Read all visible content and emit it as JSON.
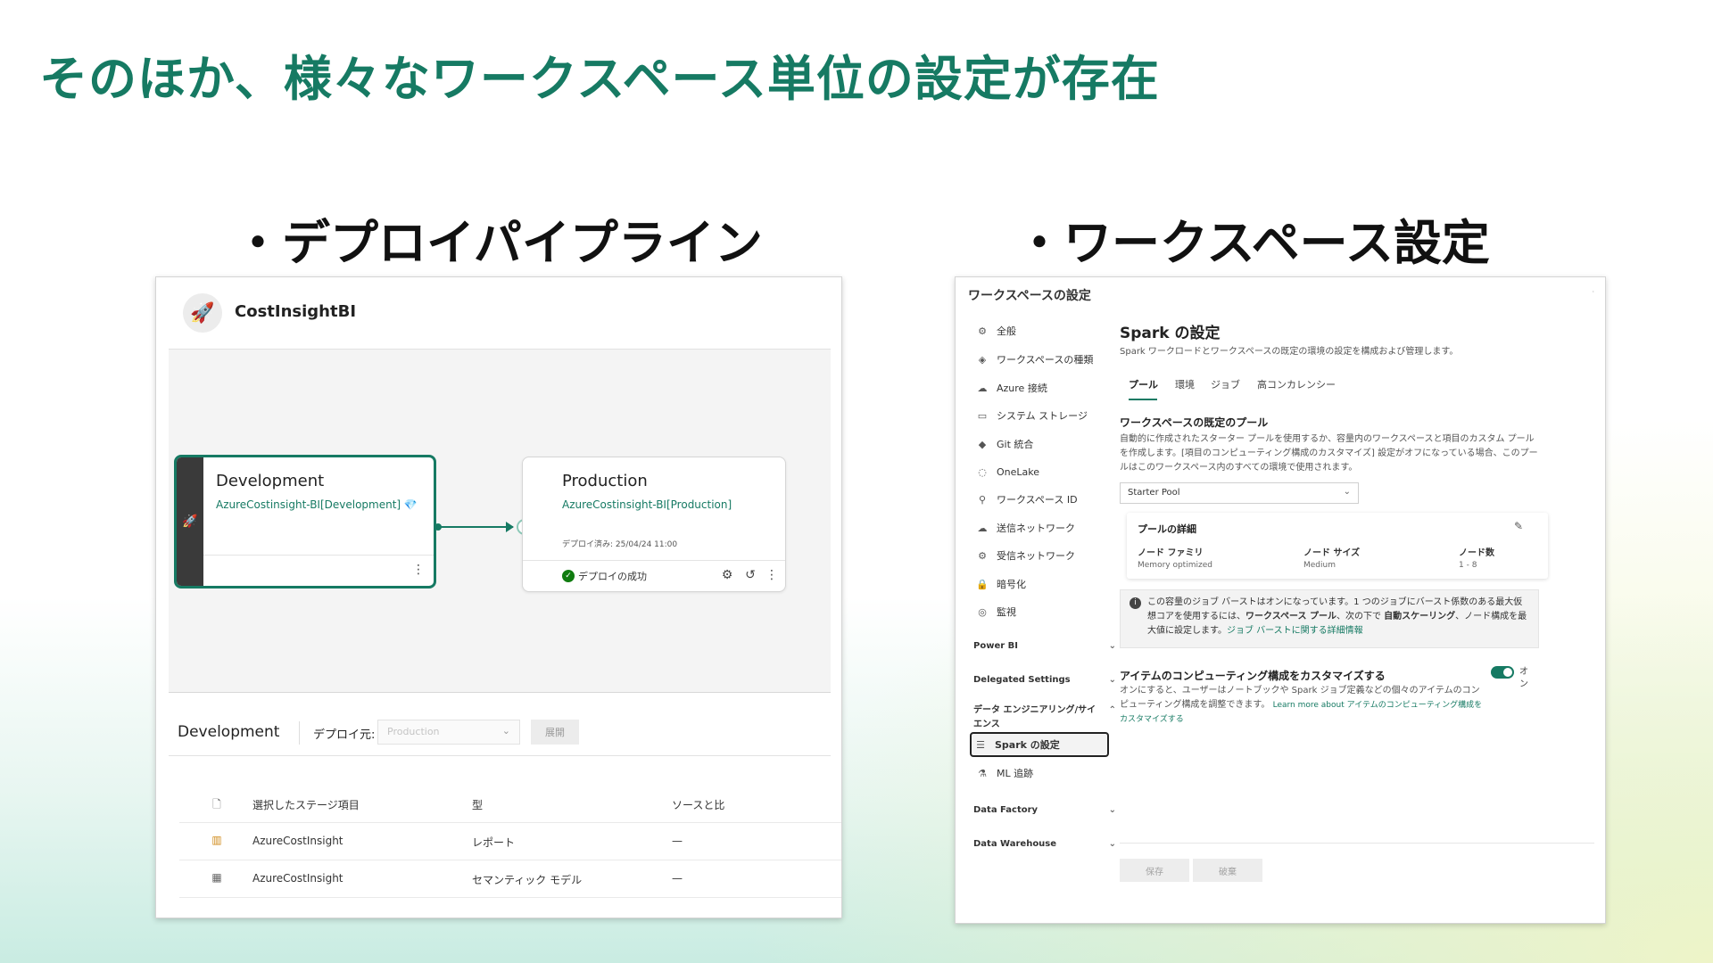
{
  "slide": {
    "title": "そのほか、様々なワークスペース単位の設定が存在",
    "left_heading": "・デプロイパイプライン",
    "right_heading": "・ワークスペース設定",
    "accent": "#167a63"
  },
  "pipeline": {
    "name": "CostInsightBI",
    "logo_icon": "rocket-icon",
    "dev_stage": {
      "title": "Development",
      "workspace": "AzureCostinsight-BI[Development] 💎"
    },
    "prod_stage": {
      "title": "Production",
      "workspace": "AzureCostinsight-BI[Production]",
      "deployed_at": "デプロイ済み: 25/04/24 11:00",
      "status": "デプロイの成功"
    },
    "toolbar": {
      "stage": "Development",
      "deploy_label": "デプロイ元:",
      "deploy_source": "Production",
      "expand_label": "展開"
    },
    "table": {
      "headers": {
        "name": "選択したステージ項目",
        "type": "型",
        "compare": "ソースと比"
      },
      "rows": [
        {
          "icon": "report-icon",
          "name": "AzureCostInsight",
          "type": "レポート",
          "compare": "—"
        },
        {
          "icon": "semantic-model-icon",
          "name": "AzureCostInsight",
          "type": "セマンティック モデル",
          "compare": "—"
        }
      ]
    }
  },
  "workspace": {
    "title": "ワークスペースの設定",
    "nav": {
      "items": [
        {
          "icon": "gear-icon",
          "label": "全般"
        },
        {
          "icon": "diamond-icon",
          "label": "ワークスペースの種類"
        },
        {
          "icon": "cloud-icon",
          "label": "Azure 接続"
        },
        {
          "icon": "storage-icon",
          "label": "システム ストレージ"
        },
        {
          "icon": "git-icon",
          "label": "Git 統合"
        },
        {
          "icon": "onelake-icon",
          "label": "OneLake"
        },
        {
          "icon": "identity-icon",
          "label": "ワークスペース ID"
        },
        {
          "icon": "outbound-network-icon",
          "label": "送信ネットワーク"
        },
        {
          "icon": "inbound-network-icon",
          "label": "受信ネットワーク"
        },
        {
          "icon": "lock-icon",
          "label": "暗号化"
        },
        {
          "icon": "monitor-icon",
          "label": "監視"
        }
      ],
      "groups": {
        "power_bi": "Power BI",
        "delegated": "Delegated Settings",
        "data_eng": "データ エンジニアリング/サイエンス",
        "data_factory": "Data Factory",
        "data_warehouse": "Data Warehouse"
      },
      "sub": {
        "spark": {
          "icon": "sliders-icon",
          "label": "Spark の設定"
        },
        "ml": {
          "icon": "flask-icon",
          "label": "ML 追跡"
        }
      }
    },
    "main": {
      "title": "Spark の設定",
      "description": "Spark ワークロードとワークスペースの既定の環境の設定を構成および管理します。",
      "tabs": [
        "プール",
        "環境",
        "ジョブ",
        "高コンカレンシー"
      ],
      "active_tab": "プール",
      "section_title": "ワークスペースの既定のプール",
      "section_desc": "自動的に作成されたスターター プールを使用するか、容量内のワークスペースと項目のカスタム プールを作成します。[項目のコンピューティング構成のカスタマイズ] 設定がオフになっている場合、このプールはこのワークスペース内のすべての環境で使用されます。",
      "pool_select": "Starter Pool",
      "pool_details": {
        "title": "プールの詳細",
        "node_family_label": "ノード ファミリ",
        "node_family": "Memory optimized",
        "node_size_label": "ノード サイズ",
        "node_size": "Medium",
        "node_count_label": "ノード数",
        "node_count": "1 - 8"
      },
      "info": {
        "text_1": "この容量のジョブ バーストはオンになっています。1 つのジョブにバースト係数のある最大仮想コアを使用するには、",
        "bold_1": "ワークスペース プール",
        "text_2": "、次の下で",
        "bold_2": "自動スケーリング",
        "text_3": "、ノード構成を最大値に設定します。",
        "link": "ジョブ バーストに関する詳細情報"
      },
      "compute": {
        "title": "アイテムのコンピューティング構成をカスタマイズする",
        "desc": "オンにすると、ユーザーはノートブックや Spark ジョブ定義などの個々のアイテムのコンピューティング構成を調整できます。",
        "link": "Learn more about アイテムのコンピューティング構成をカスタマイズする",
        "toggle_label": "オン"
      },
      "save": "保存",
      "discard": "破棄"
    }
  }
}
